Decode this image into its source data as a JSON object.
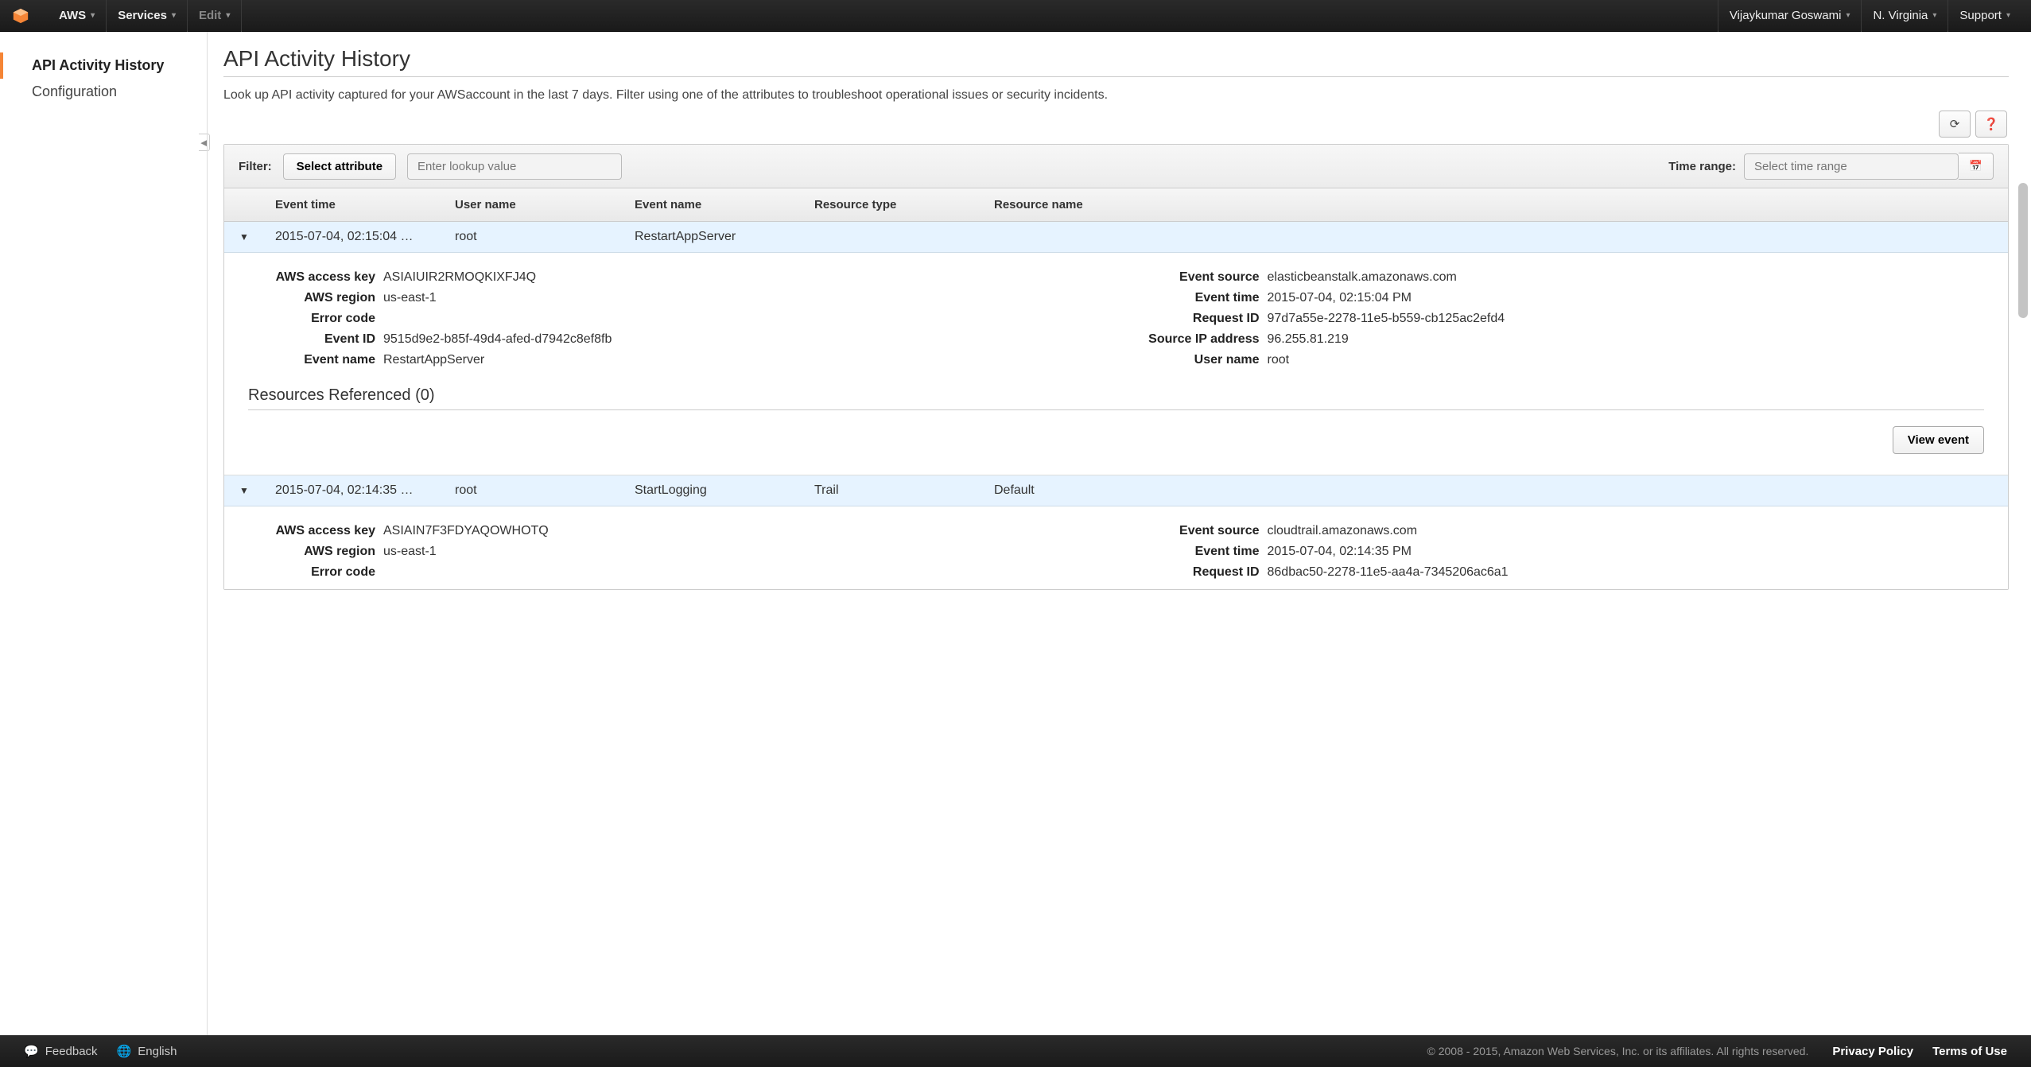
{
  "topnav": {
    "aws": "AWS",
    "services": "Services",
    "edit": "Edit",
    "user": "Vijaykumar Goswami",
    "region": "N. Virginia",
    "support": "Support"
  },
  "sidebar": {
    "items": [
      {
        "label": "API Activity History",
        "active": true
      },
      {
        "label": "Configuration",
        "active": false
      }
    ]
  },
  "page": {
    "title": "API Activity History",
    "desc": "Look up API activity captured for your AWSaccount in the last 7 days. Filter using one of the attributes to troubleshoot operational issues or security incidents."
  },
  "filter": {
    "label": "Filter:",
    "select_attr": "Select attribute",
    "lookup_placeholder": "Enter lookup value",
    "time_range_label": "Time range:",
    "time_range_placeholder": "Select time range"
  },
  "columns": {
    "event_time": "Event time",
    "user_name": "User name",
    "event_name": "Event name",
    "resource_type": "Resource type",
    "resource_name": "Resource name"
  },
  "rows": [
    {
      "summary": {
        "time": "2015-07-04, 02:15:04 …",
        "user": "root",
        "event": "RestartAppServer",
        "restype": "",
        "resname": ""
      },
      "detail_left": [
        {
          "k": "AWS access key",
          "v": "ASIAIUIR2RMOQKIXFJ4Q"
        },
        {
          "k": "AWS region",
          "v": "us-east-1"
        },
        {
          "k": "Error code",
          "v": ""
        },
        {
          "k": "Event ID",
          "v": "9515d9e2-b85f-49d4-afed-d7942c8ef8fb"
        },
        {
          "k": "Event name",
          "v": "RestartAppServer"
        }
      ],
      "detail_right": [
        {
          "k": "Event source",
          "v": "elasticbeanstalk.amazonaws.com"
        },
        {
          "k": "Event time",
          "v": "2015-07-04, 02:15:04 PM"
        },
        {
          "k": "Request ID",
          "v": "97d7a55e-2278-11e5-b559-cb125ac2efd4"
        },
        {
          "k": "Source IP address",
          "v": "96.255.81.219"
        },
        {
          "k": "User name",
          "v": "root"
        }
      ],
      "resources_header": "Resources Referenced (0)",
      "view_event": "View event"
    },
    {
      "summary": {
        "time": "2015-07-04, 02:14:35 …",
        "user": "root",
        "event": "StartLogging",
        "restype": "Trail",
        "resname": "Default"
      },
      "detail_left": [
        {
          "k": "AWS access key",
          "v": "ASIAIN7F3FDYAQOWHOTQ"
        },
        {
          "k": "AWS region",
          "v": "us-east-1"
        },
        {
          "k": "Error code",
          "v": ""
        }
      ],
      "detail_right": [
        {
          "k": "Event source",
          "v": "cloudtrail.amazonaws.com"
        },
        {
          "k": "Event time",
          "v": "2015-07-04, 02:14:35 PM"
        },
        {
          "k": "Request ID",
          "v": "86dbac50-2278-11e5-aa4a-7345206ac6a1"
        }
      ]
    }
  ],
  "footer": {
    "feedback": "Feedback",
    "language": "English",
    "copyright": "© 2008 - 2015, Amazon Web Services, Inc. or its affiliates. All rights reserved.",
    "privacy": "Privacy Policy",
    "terms": "Terms of Use"
  }
}
